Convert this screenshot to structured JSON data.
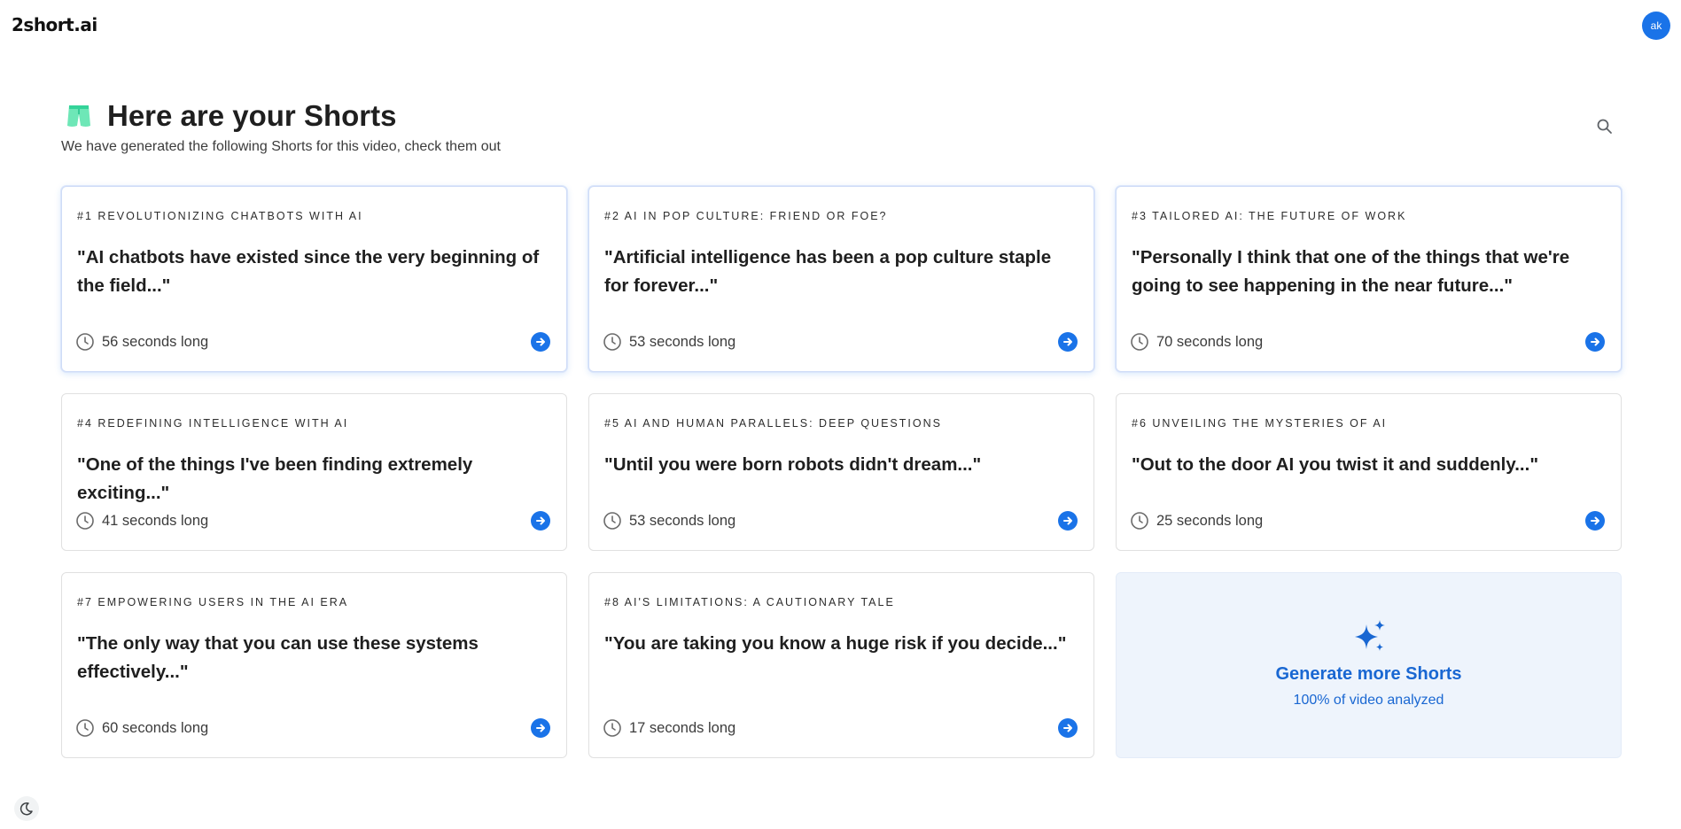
{
  "app": {
    "logo": "2short.ai",
    "avatar_initials": "ak",
    "accent_color": "#1a73e8"
  },
  "header": {
    "title": "Here are your Shorts",
    "subtitle": "We have generated the following Shorts for this video, check them out",
    "icon": "shorts-icon"
  },
  "search": {
    "icon": "search-icon"
  },
  "shorts": [
    {
      "label": "#1 REVOLUTIONIZING CHATBOTS WITH AI",
      "quote": "\"AI chatbots have existed since the very beginning of the field...\"",
      "duration": "56 seconds long"
    },
    {
      "label": "#2 AI IN POP CULTURE: FRIEND OR FOE?",
      "quote": "\"Artificial intelligence has been a pop culture staple for forever...\"",
      "duration": "53 seconds long"
    },
    {
      "label": "#3 TAILORED AI: THE FUTURE OF WORK",
      "quote": "\"Personally I think that one of the things that we're going to see happening in the near future...\"",
      "duration": "70 seconds long"
    },
    {
      "label": "#4 REDEFINING INTELLIGENCE WITH AI",
      "quote": "\"One of the things I've been finding extremely exciting...\"",
      "duration": "41 seconds long"
    },
    {
      "label": "#5 AI AND HUMAN PARALLELS: DEEP QUESTIONS",
      "quote": "\"Until you were born robots didn't dream...\"",
      "duration": "53 seconds long"
    },
    {
      "label": "#6 UNVEILING THE MYSTERIES OF AI",
      "quote": "\"Out to the door AI you twist it and suddenly...\"",
      "duration": "25 seconds long"
    },
    {
      "label": "#7 EMPOWERING USERS IN THE AI ERA",
      "quote": "\"The only way that you can use these systems effectively...\"",
      "duration": "60 seconds long"
    },
    {
      "label": "#8 AI'S LIMITATIONS: A CAUTIONARY TALE",
      "quote": "\"You are taking you know a huge risk if you decide...\"",
      "duration": "17 seconds long"
    }
  ],
  "generate": {
    "title": "Generate more Shorts",
    "subtitle": "100% of video analyzed",
    "icon": "sparkles-icon"
  },
  "theme_toggle": {
    "icon": "moon-icon"
  }
}
